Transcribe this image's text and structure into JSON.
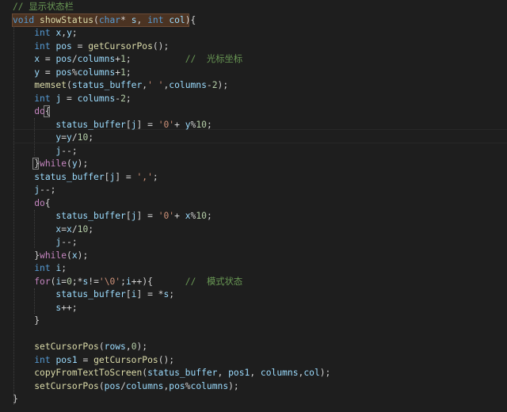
{
  "editor": {
    "language": "c",
    "colors": {
      "background": "#1e1e1e",
      "keyword": "#569cd6",
      "control": "#c586c0",
      "function": "#dcdcaa",
      "variable": "#9cdcfe",
      "number": "#b5cea8",
      "string": "#ce9178",
      "comment": "#6a9955",
      "plain": "#d4d4d4"
    },
    "lines": [
      [
        [
          "cmt",
          "// 显示状态栏"
        ]
      ],
      [
        [
          "kw",
          "void"
        ],
        [
          "txt",
          " "
        ],
        [
          "fn",
          "showStatus"
        ],
        [
          "txt",
          "("
        ],
        [
          "kw",
          "char"
        ],
        [
          "txt",
          "* "
        ],
        [
          "var",
          "s"
        ],
        [
          "txt",
          ", "
        ],
        [
          "kw",
          "int"
        ],
        [
          "txt",
          " "
        ],
        [
          "var",
          "col"
        ],
        [
          "txt",
          "){"
        ]
      ],
      [
        [
          "txt",
          "    "
        ],
        [
          "kw",
          "int"
        ],
        [
          "txt",
          " "
        ],
        [
          "var",
          "x"
        ],
        [
          "txt",
          ","
        ],
        [
          "var",
          "y"
        ],
        [
          "txt",
          ";"
        ]
      ],
      [
        [
          "txt",
          "    "
        ],
        [
          "kw",
          "int"
        ],
        [
          "txt",
          " "
        ],
        [
          "var",
          "pos"
        ],
        [
          "txt",
          " = "
        ],
        [
          "fn",
          "getCursorPos"
        ],
        [
          "txt",
          "();"
        ]
      ],
      [
        [
          "txt",
          "    "
        ],
        [
          "var",
          "x"
        ],
        [
          "txt",
          " = "
        ],
        [
          "var",
          "pos"
        ],
        [
          "txt",
          "/"
        ],
        [
          "var",
          "columns"
        ],
        [
          "txt",
          "+"
        ],
        [
          "num",
          "1"
        ],
        [
          "txt",
          ";          "
        ],
        [
          "cmt",
          "//  光标坐标"
        ]
      ],
      [
        [
          "txt",
          "    "
        ],
        [
          "var",
          "y"
        ],
        [
          "txt",
          " = "
        ],
        [
          "var",
          "pos"
        ],
        [
          "txt",
          "%"
        ],
        [
          "var",
          "columns"
        ],
        [
          "txt",
          "+"
        ],
        [
          "num",
          "1"
        ],
        [
          "txt",
          ";"
        ]
      ],
      [
        [
          "txt",
          "    "
        ],
        [
          "fn",
          "memset"
        ],
        [
          "txt",
          "("
        ],
        [
          "var",
          "status_buffer"
        ],
        [
          "txt",
          ","
        ],
        [
          "str",
          "' '"
        ],
        [
          "txt",
          ","
        ],
        [
          "var",
          "columns"
        ],
        [
          "txt",
          "-"
        ],
        [
          "num",
          "2"
        ],
        [
          "txt",
          ");"
        ]
      ],
      [
        [
          "txt",
          "    "
        ],
        [
          "kw",
          "int"
        ],
        [
          "txt",
          " "
        ],
        [
          "var",
          "j"
        ],
        [
          "txt",
          " = "
        ],
        [
          "var",
          "columns"
        ],
        [
          "txt",
          "-"
        ],
        [
          "num",
          "2"
        ],
        [
          "txt",
          ";"
        ]
      ],
      [
        [
          "txt",
          "    "
        ],
        [
          "ctrl",
          "do"
        ],
        [
          "txt",
          "{"
        ]
      ],
      [
        [
          "txt",
          "        "
        ],
        [
          "var",
          "status_buffer"
        ],
        [
          "txt",
          "["
        ],
        [
          "var",
          "j"
        ],
        [
          "txt",
          "] = "
        ],
        [
          "str",
          "'0'"
        ],
        [
          "txt",
          "+ "
        ],
        [
          "var",
          "y"
        ],
        [
          "txt",
          "%"
        ],
        [
          "num",
          "10"
        ],
        [
          "txt",
          ";"
        ]
      ],
      [
        [
          "txt",
          "        "
        ],
        [
          "var",
          "y"
        ],
        [
          "txt",
          "="
        ],
        [
          "var",
          "y"
        ],
        [
          "txt",
          "/"
        ],
        [
          "num",
          "10"
        ],
        [
          "txt",
          ";"
        ]
      ],
      [
        [
          "txt",
          "        "
        ],
        [
          "var",
          "j"
        ],
        [
          "txt",
          "--;"
        ]
      ],
      [
        [
          "txt",
          "    }"
        ],
        [
          "ctrl",
          "while"
        ],
        [
          "txt",
          "("
        ],
        [
          "var",
          "y"
        ],
        [
          "txt",
          ");"
        ]
      ],
      [
        [
          "txt",
          "    "
        ],
        [
          "var",
          "status_buffer"
        ],
        [
          "txt",
          "["
        ],
        [
          "var",
          "j"
        ],
        [
          "txt",
          "] = "
        ],
        [
          "str",
          "','"
        ],
        [
          "txt",
          ";"
        ]
      ],
      [
        [
          "txt",
          "    "
        ],
        [
          "var",
          "j"
        ],
        [
          "txt",
          "--;"
        ]
      ],
      [
        [
          "txt",
          "    "
        ],
        [
          "ctrl",
          "do"
        ],
        [
          "txt",
          "{"
        ]
      ],
      [
        [
          "txt",
          "        "
        ],
        [
          "var",
          "status_buffer"
        ],
        [
          "txt",
          "["
        ],
        [
          "var",
          "j"
        ],
        [
          "txt",
          "] = "
        ],
        [
          "str",
          "'0'"
        ],
        [
          "txt",
          "+ "
        ],
        [
          "var",
          "x"
        ],
        [
          "txt",
          "%"
        ],
        [
          "num",
          "10"
        ],
        [
          "txt",
          ";"
        ]
      ],
      [
        [
          "txt",
          "        "
        ],
        [
          "var",
          "x"
        ],
        [
          "txt",
          "="
        ],
        [
          "var",
          "x"
        ],
        [
          "txt",
          "/"
        ],
        [
          "num",
          "10"
        ],
        [
          "txt",
          ";"
        ]
      ],
      [
        [
          "txt",
          "        "
        ],
        [
          "var",
          "j"
        ],
        [
          "txt",
          "--;"
        ]
      ],
      [
        [
          "txt",
          "    }"
        ],
        [
          "ctrl",
          "while"
        ],
        [
          "txt",
          "("
        ],
        [
          "var",
          "x"
        ],
        [
          "txt",
          ");"
        ]
      ],
      [
        [
          "txt",
          "    "
        ],
        [
          "kw",
          "int"
        ],
        [
          "txt",
          " "
        ],
        [
          "var",
          "i"
        ],
        [
          "txt",
          ";"
        ]
      ],
      [
        [
          "txt",
          "    "
        ],
        [
          "ctrl",
          "for"
        ],
        [
          "txt",
          "("
        ],
        [
          "var",
          "i"
        ],
        [
          "txt",
          "="
        ],
        [
          "num",
          "0"
        ],
        [
          "txt",
          ";*"
        ],
        [
          "var",
          "s"
        ],
        [
          "txt",
          "!="
        ],
        [
          "str",
          "'\\0'"
        ],
        [
          "txt",
          ";"
        ],
        [
          "var",
          "i"
        ],
        [
          "txt",
          "++){      "
        ],
        [
          "cmt",
          "//  模式状态"
        ]
      ],
      [
        [
          "txt",
          "        "
        ],
        [
          "var",
          "status_buffer"
        ],
        [
          "txt",
          "["
        ],
        [
          "var",
          "i"
        ],
        [
          "txt",
          "] = *"
        ],
        [
          "var",
          "s"
        ],
        [
          "txt",
          ";"
        ]
      ],
      [
        [
          "txt",
          "        "
        ],
        [
          "var",
          "s"
        ],
        [
          "txt",
          "++;"
        ]
      ],
      [
        [
          "txt",
          "    }"
        ]
      ],
      [
        [
          "txt",
          ""
        ]
      ],
      [
        [
          "txt",
          "    "
        ],
        [
          "fn",
          "setCursorPos"
        ],
        [
          "txt",
          "("
        ],
        [
          "var",
          "rows"
        ],
        [
          "txt",
          ","
        ],
        [
          "num",
          "0"
        ],
        [
          "txt",
          ");"
        ]
      ],
      [
        [
          "txt",
          "    "
        ],
        [
          "kw",
          "int"
        ],
        [
          "txt",
          " "
        ],
        [
          "var",
          "pos1"
        ],
        [
          "txt",
          " = "
        ],
        [
          "fn",
          "getCursorPos"
        ],
        [
          "txt",
          "();"
        ]
      ],
      [
        [
          "txt",
          "    "
        ],
        [
          "fn",
          "copyFromTextToScreen"
        ],
        [
          "txt",
          "("
        ],
        [
          "var",
          "status_buffer"
        ],
        [
          "txt",
          ", "
        ],
        [
          "var",
          "pos1"
        ],
        [
          "txt",
          ", "
        ],
        [
          "var",
          "columns"
        ],
        [
          "txt",
          ","
        ],
        [
          "var",
          "col"
        ],
        [
          "txt",
          ");"
        ]
      ],
      [
        [
          "txt",
          "    "
        ],
        [
          "fn",
          "setCursorPos"
        ],
        [
          "txt",
          "("
        ],
        [
          "var",
          "pos"
        ],
        [
          "txt",
          "/"
        ],
        [
          "var",
          "columns"
        ],
        [
          "txt",
          ","
        ],
        [
          "var",
          "pos"
        ],
        [
          "txt",
          "%"
        ],
        [
          "var",
          "columns"
        ],
        [
          "txt",
          ");"
        ]
      ],
      [
        [
          "txt",
          "}"
        ]
      ]
    ]
  }
}
